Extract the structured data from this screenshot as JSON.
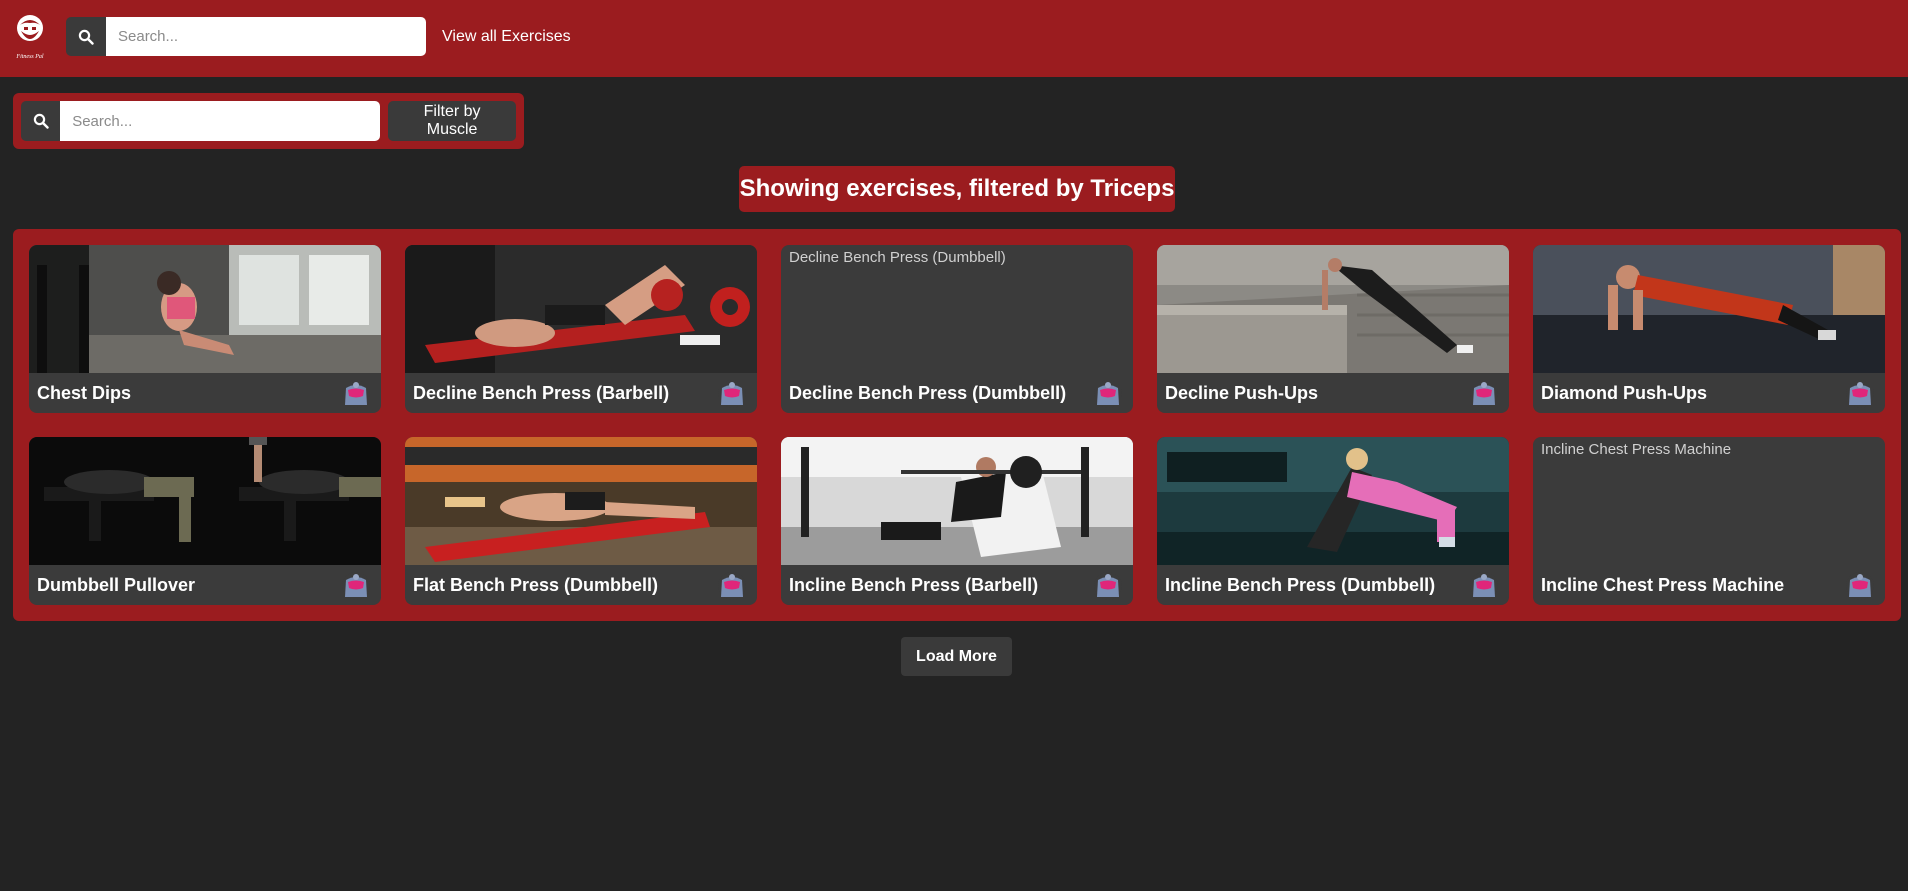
{
  "nav": {
    "logo_text": "Fitness Pal",
    "search_placeholder": "Search...",
    "view_all_label": "View all Exercises"
  },
  "filter": {
    "search_placeholder": "Search...",
    "button_label": "Filter by Muscle"
  },
  "heading": "Showing exercises, filtered by Triceps",
  "exercises": [
    {
      "name": "Chest Dips",
      "image": "photo",
      "alt": "",
      "muscle_icon": "chest-muscle-icon"
    },
    {
      "name": "Decline Bench Press (Barbell)",
      "image": "photo",
      "alt": "",
      "muscle_icon": "chest-muscle-icon"
    },
    {
      "name": "Decline Bench Press (Dumbbell)",
      "image": "missing",
      "alt": "Decline Bench Press (Dumbbell)",
      "muscle_icon": "chest-muscle-icon"
    },
    {
      "name": "Decline Push-Ups",
      "image": "photo",
      "alt": "",
      "muscle_icon": "chest-muscle-icon"
    },
    {
      "name": "Diamond Push-Ups",
      "image": "photo",
      "alt": "",
      "muscle_icon": "chest-muscle-icon"
    },
    {
      "name": "Dumbbell Pullover",
      "image": "photo",
      "alt": "",
      "muscle_icon": "chest-muscle-icon"
    },
    {
      "name": "Flat Bench Press (Dumbbell)",
      "image": "photo",
      "alt": "",
      "muscle_icon": "chest-muscle-icon"
    },
    {
      "name": "Incline Bench Press (Barbell)",
      "image": "photo",
      "alt": "",
      "muscle_icon": "chest-muscle-icon"
    },
    {
      "name": "Incline Bench Press (Dumbbell)",
      "image": "photo",
      "alt": "",
      "muscle_icon": "chest-muscle-icon"
    },
    {
      "name": "Incline Chest Press Machine",
      "image": "missing",
      "alt": "Incline Chest Press Machine",
      "muscle_icon": "chest-muscle-icon"
    }
  ],
  "load_more_label": "Load More",
  "colors": {
    "brand_red": "#9b1c1f",
    "background": "#232323",
    "card": "#3b3b3b",
    "button_dark": "#3a3a3a"
  }
}
